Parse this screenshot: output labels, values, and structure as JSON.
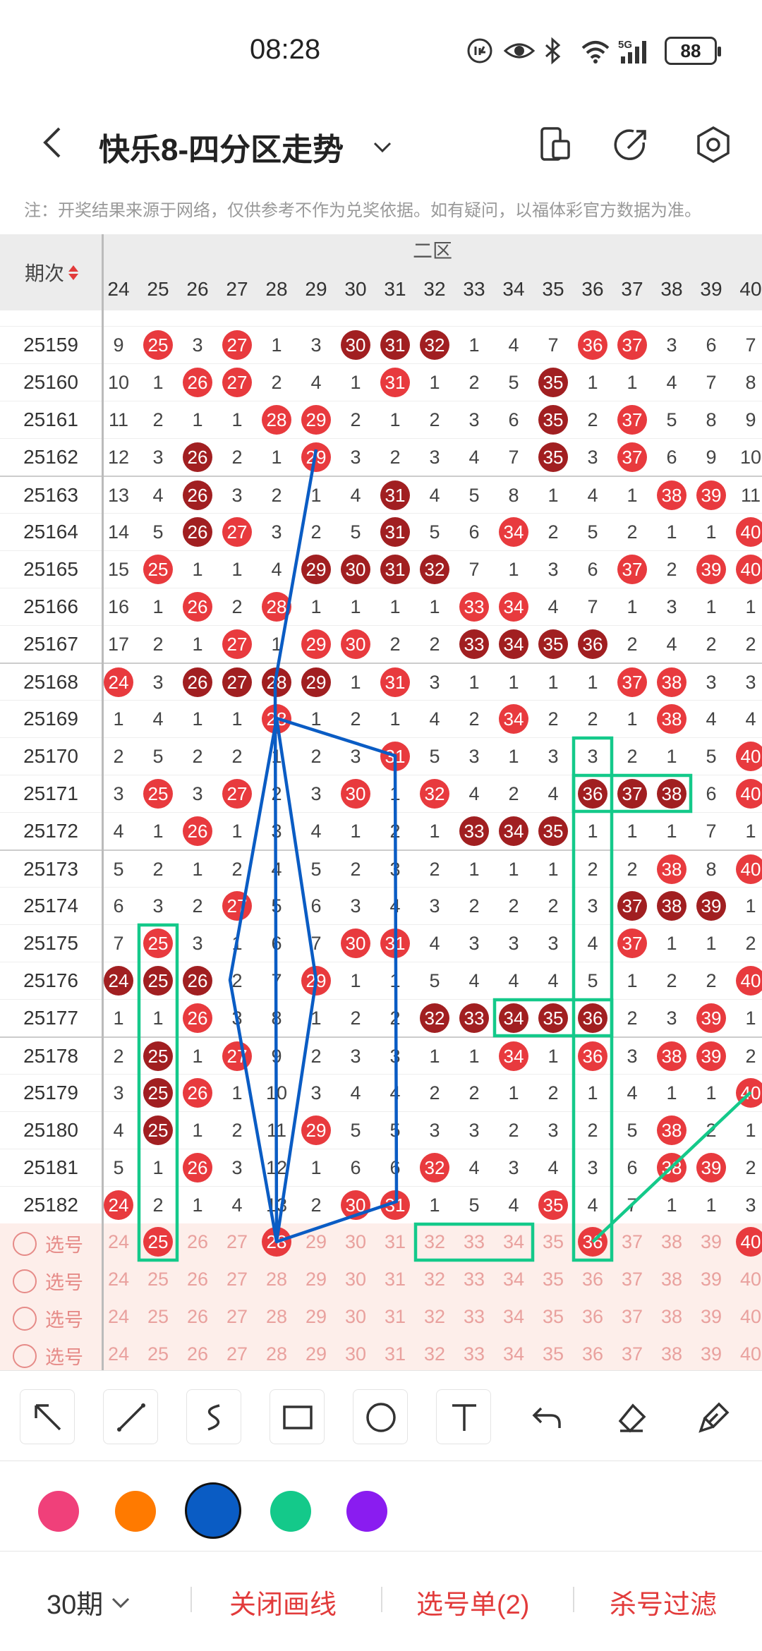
{
  "status_bar": {
    "time": "08:28",
    "battery": "88",
    "network": "5G",
    "icons": [
      "data-saver-icon",
      "eye-icon",
      "bluetooth-icon",
      "wifi-icon",
      "signal-icon",
      "battery-icon"
    ]
  },
  "app_bar": {
    "title": "快乐8-四分区走势",
    "icons": [
      "back-icon",
      "chevron-down-icon",
      "device-icon",
      "share-icon",
      "settings-icon"
    ]
  },
  "note": "注：开奖结果来源于网络，仅供参考不作为兑奖依据。如有疑问，以福体彩官方数据为准。",
  "grid": {
    "left_header": "期次",
    "zone_label": "二区",
    "columns": [
      "24",
      "25",
      "26",
      "27",
      "28",
      "29",
      "30",
      "31",
      "32",
      "33",
      "34",
      "35",
      "36",
      "37",
      "38",
      "39",
      "40"
    ],
    "rows": [
      {
        "period": "25159",
        "cells": [
          "9",
          "25",
          "3",
          "27",
          "1",
          "3",
          "30",
          "31",
          "32",
          "1",
          "4",
          "7",
          "36",
          "37",
          "3",
          "6",
          "7"
        ],
        "red": [
          1,
          3,
          12,
          13
        ],
        "dark": [
          6,
          7,
          8
        ]
      },
      {
        "period": "25160",
        "cells": [
          "10",
          "1",
          "26",
          "27",
          "2",
          "4",
          "1",
          "31",
          "1",
          "2",
          "5",
          "35",
          "1",
          "1",
          "4",
          "7",
          "8"
        ],
        "red": [
          2,
          3,
          7
        ],
        "dark": [
          11
        ]
      },
      {
        "period": "25161",
        "cells": [
          "11",
          "2",
          "1",
          "1",
          "28",
          "29",
          "2",
          "1",
          "2",
          "3",
          "6",
          "35",
          "2",
          "37",
          "5",
          "8",
          "9"
        ],
        "red": [
          4,
          5,
          13
        ],
        "dark": [
          11
        ]
      },
      {
        "period": "25162",
        "cells": [
          "12",
          "3",
          "26",
          "2",
          "1",
          "29",
          "3",
          "2",
          "3",
          "4",
          "7",
          "35",
          "3",
          "37",
          "6",
          "9",
          "10"
        ],
        "red": [
          5,
          13
        ],
        "dark": [
          2,
          11
        ]
      },
      {
        "period": "25163",
        "cells": [
          "13",
          "4",
          "26",
          "3",
          "2",
          "1",
          "4",
          "31",
          "4",
          "5",
          "8",
          "1",
          "4",
          "1",
          "38",
          "39",
          "11"
        ],
        "red": [
          14,
          15
        ],
        "dark": [
          2,
          7
        ]
      },
      {
        "period": "25164",
        "cells": [
          "14",
          "5",
          "26",
          "27",
          "3",
          "2",
          "5",
          "31",
          "5",
          "6",
          "34",
          "2",
          "5",
          "2",
          "1",
          "1",
          "40"
        ],
        "red": [
          3,
          10,
          16
        ],
        "dark": [
          2,
          7
        ]
      },
      {
        "period": "25165",
        "cells": [
          "15",
          "25",
          "1",
          "1",
          "4",
          "29",
          "30",
          "31",
          "32",
          "7",
          "1",
          "3",
          "6",
          "37",
          "2",
          "39",
          "40"
        ],
        "red": [
          1,
          13,
          15,
          16
        ],
        "dark": [
          5,
          6,
          7,
          8
        ]
      },
      {
        "period": "25166",
        "cells": [
          "16",
          "1",
          "26",
          "2",
          "28",
          "1",
          "1",
          "1",
          "1",
          "33",
          "34",
          "4",
          "7",
          "1",
          "3",
          "1",
          "1"
        ],
        "red": [
          2,
          4,
          9,
          10
        ],
        "dark": []
      },
      {
        "period": "25167",
        "cells": [
          "17",
          "2",
          "1",
          "27",
          "1",
          "29",
          "30",
          "2",
          "2",
          "33",
          "34",
          "35",
          "36",
          "2",
          "4",
          "2",
          "2"
        ],
        "red": [
          3,
          5,
          6
        ],
        "dark": [
          9,
          10,
          11,
          12
        ]
      },
      {
        "period": "25168",
        "cells": [
          "24",
          "3",
          "26",
          "27",
          "28",
          "29",
          "1",
          "31",
          "3",
          "1",
          "1",
          "1",
          "1",
          "37",
          "38",
          "3",
          "3"
        ],
        "red": [
          0,
          7,
          13,
          14
        ],
        "dark": [
          2,
          3,
          4,
          5
        ]
      },
      {
        "period": "25169",
        "cells": [
          "1",
          "4",
          "1",
          "1",
          "28",
          "1",
          "2",
          "1",
          "4",
          "2",
          "34",
          "2",
          "2",
          "1",
          "38",
          "4",
          "4"
        ],
        "red": [
          4,
          10,
          14
        ],
        "dark": []
      },
      {
        "period": "25170",
        "cells": [
          "2",
          "5",
          "2",
          "2",
          "1",
          "2",
          "3",
          "31",
          "5",
          "3",
          "1",
          "3",
          "3",
          "2",
          "1",
          "5",
          "40"
        ],
        "red": [
          7,
          16
        ],
        "dark": []
      },
      {
        "period": "25171",
        "cells": [
          "3",
          "25",
          "3",
          "27",
          "2",
          "3",
          "30",
          "1",
          "32",
          "4",
          "2",
          "4",
          "36",
          "37",
          "38",
          "6",
          "40"
        ],
        "red": [
          1,
          3,
          6,
          8,
          16
        ],
        "dark": [
          12,
          13,
          14
        ]
      },
      {
        "period": "25172",
        "cells": [
          "4",
          "1",
          "26",
          "1",
          "3",
          "4",
          "1",
          "2",
          "1",
          "33",
          "34",
          "35",
          "1",
          "1",
          "1",
          "7",
          "1"
        ],
        "red": [
          2
        ],
        "dark": [
          9,
          10,
          11
        ]
      },
      {
        "period": "25173",
        "cells": [
          "5",
          "2",
          "1",
          "2",
          "4",
          "5",
          "2",
          "3",
          "2",
          "1",
          "1",
          "1",
          "2",
          "2",
          "38",
          "8",
          "40"
        ],
        "red": [
          14,
          16
        ],
        "dark": []
      },
      {
        "period": "25174",
        "cells": [
          "6",
          "3",
          "2",
          "27",
          "5",
          "6",
          "3",
          "4",
          "3",
          "2",
          "2",
          "2",
          "3",
          "37",
          "38",
          "39",
          "1"
        ],
        "red": [
          3
        ],
        "dark": [
          13,
          14,
          15
        ]
      },
      {
        "period": "25175",
        "cells": [
          "7",
          "25",
          "3",
          "1",
          "6",
          "7",
          "30",
          "31",
          "4",
          "3",
          "3",
          "3",
          "4",
          "37",
          "1",
          "1",
          "2"
        ],
        "red": [
          1,
          6,
          7,
          13
        ],
        "dark": []
      },
      {
        "period": "25176",
        "cells": [
          "24",
          "25",
          "26",
          "2",
          "7",
          "29",
          "1",
          "1",
          "5",
          "4",
          "4",
          "4",
          "5",
          "1",
          "2",
          "2",
          "40"
        ],
        "red": [
          5,
          16
        ],
        "dark": [
          0,
          1,
          2
        ]
      },
      {
        "period": "25177",
        "cells": [
          "1",
          "1",
          "26",
          "3",
          "8",
          "1",
          "2",
          "2",
          "32",
          "33",
          "34",
          "35",
          "36",
          "2",
          "3",
          "39",
          "1"
        ],
        "red": [
          2,
          15
        ],
        "dark": [
          8,
          9,
          10,
          11,
          12
        ]
      },
      {
        "period": "25178",
        "cells": [
          "2",
          "25",
          "1",
          "27",
          "9",
          "2",
          "3",
          "3",
          "1",
          "1",
          "34",
          "1",
          "36",
          "3",
          "38",
          "39",
          "2"
        ],
        "red": [
          3,
          10,
          12,
          14,
          15
        ],
        "dark": [
          1
        ]
      },
      {
        "period": "25179",
        "cells": [
          "3",
          "25",
          "26",
          "1",
          "10",
          "3",
          "4",
          "4",
          "2",
          "2",
          "1",
          "2",
          "1",
          "4",
          "1",
          "1",
          "40"
        ],
        "red": [
          2,
          16
        ],
        "dark": [
          1
        ]
      },
      {
        "period": "25180",
        "cells": [
          "4",
          "25",
          "1",
          "2",
          "11",
          "29",
          "5",
          "5",
          "3",
          "3",
          "2",
          "3",
          "2",
          "5",
          "38",
          "2",
          "1"
        ],
        "red": [
          5,
          14
        ],
        "dark": [
          1
        ]
      },
      {
        "period": "25181",
        "cells": [
          "5",
          "1",
          "26",
          "3",
          "12",
          "1",
          "6",
          "6",
          "32",
          "4",
          "3",
          "4",
          "3",
          "6",
          "38",
          "39",
          "2"
        ],
        "red": [
          2,
          8,
          14,
          15
        ],
        "dark": []
      },
      {
        "period": "25182",
        "cells": [
          "24",
          "2",
          "1",
          "4",
          "13",
          "2",
          "30",
          "31",
          "1",
          "5",
          "4",
          "35",
          "4",
          "7",
          "1",
          "1",
          "3"
        ],
        "red": [
          0,
          6,
          7,
          11
        ],
        "dark": []
      }
    ],
    "pick_rows": [
      {
        "label": "选号",
        "cells": [
          "24",
          "25",
          "26",
          "27",
          "28",
          "29",
          "30",
          "31",
          "32",
          "33",
          "34",
          "35",
          "36",
          "37",
          "38",
          "39",
          "40"
        ],
        "red": [
          1,
          4,
          12,
          16
        ]
      },
      {
        "label": "选号",
        "cells": [
          "24",
          "25",
          "26",
          "27",
          "28",
          "29",
          "30",
          "31",
          "32",
          "33",
          "34",
          "35",
          "36",
          "37",
          "38",
          "39",
          "40"
        ],
        "red": []
      },
      {
        "label": "选号",
        "cells": [
          "24",
          "25",
          "26",
          "27",
          "28",
          "29",
          "30",
          "31",
          "32",
          "33",
          "34",
          "35",
          "36",
          "37",
          "38",
          "39",
          "40"
        ],
        "red": []
      },
      {
        "label": "选号",
        "cells": [
          "24",
          "25",
          "26",
          "27",
          "28",
          "29",
          "30",
          "31",
          "32",
          "33",
          "34",
          "35",
          "36",
          "37",
          "38",
          "39",
          "40"
        ],
        "red": []
      }
    ]
  },
  "toolbar": {
    "tools": [
      "arrow-tool",
      "line-tool",
      "freehand-tool",
      "rectangle-tool",
      "circle-tool",
      "text-tool",
      "undo-tool",
      "eraser-tool",
      "clear-tool"
    ]
  },
  "colors": {
    "swatches": [
      "#f0407a",
      "#ff7a00",
      "#0a5cc4",
      "#14c98a",
      "#8a1cf0"
    ],
    "selected": "#0a5cc4",
    "ball_red": "#e83a3e",
    "ball_dark": "#a11f21"
  },
  "bottom_bar": {
    "period": "30期",
    "close_lines": "关闭画线",
    "pick_list": "选号单(2)",
    "kill_filter": "杀号过滤"
  }
}
